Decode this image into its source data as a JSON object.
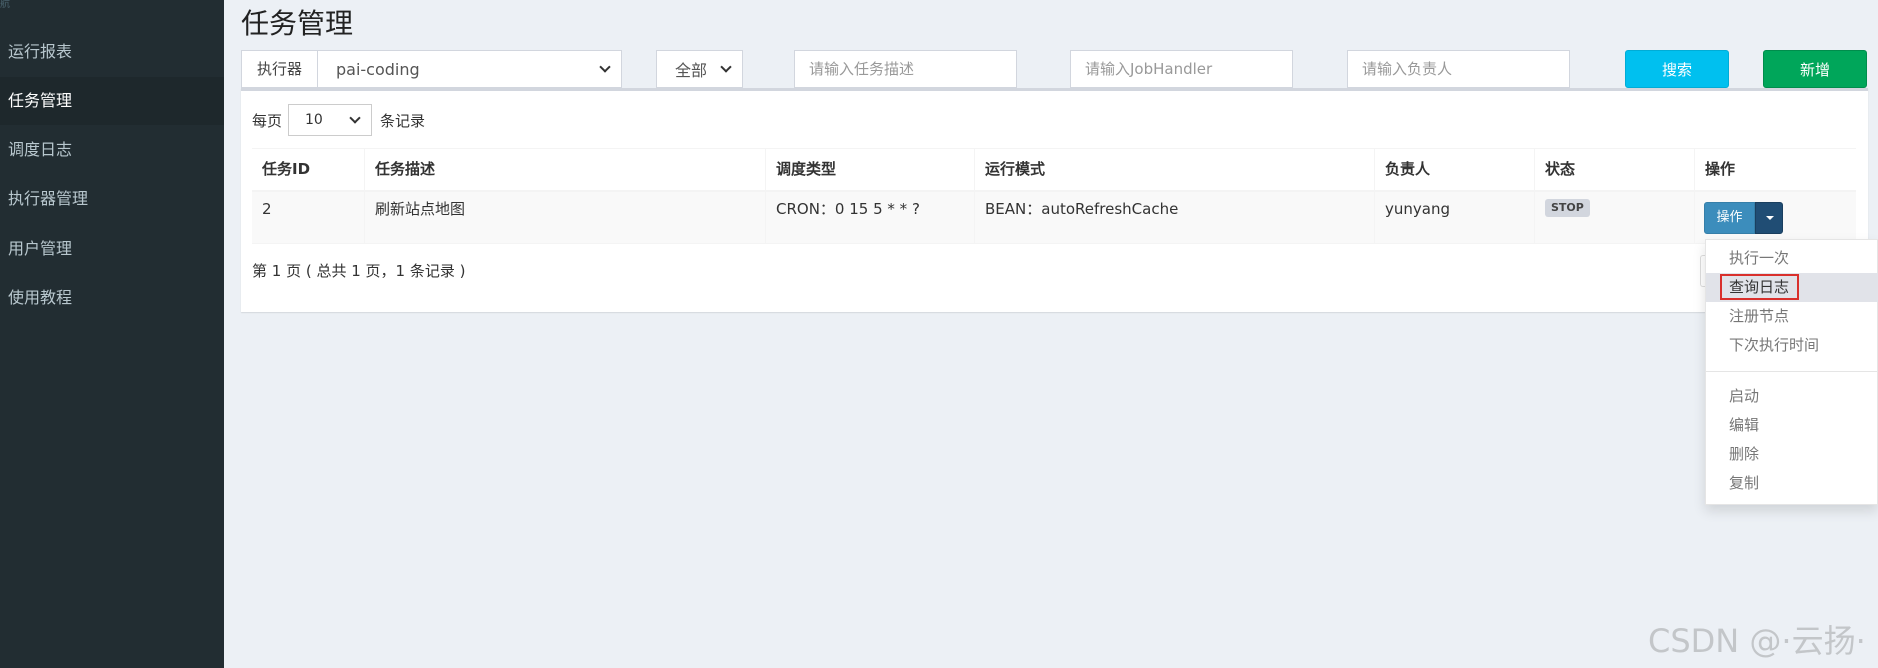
{
  "sidebar": {
    "header": "航",
    "items": [
      {
        "label": "运行报表"
      },
      {
        "label": "任务管理"
      },
      {
        "label": "调度日志"
      },
      {
        "label": "执行器管理"
      },
      {
        "label": "用户管理"
      },
      {
        "label": "使用教程"
      }
    ],
    "active_index": 1
  },
  "page": {
    "title": "任务管理"
  },
  "filters": {
    "executor_label": "执行器",
    "executor_value": "pai-coding",
    "status_value": "全部",
    "desc_placeholder": "请输入任务描述",
    "handler_placeholder": "请输入JobHandler",
    "author_placeholder": "请输入负责人",
    "search_label": "搜索",
    "add_label": "新增"
  },
  "paging": {
    "per_page_prefix": "每页",
    "per_page_value": "10",
    "per_page_suffix": "条记录",
    "info": "第 1 页 ( 总共 1 页，1 条记录 )"
  },
  "table": {
    "columns": [
      "任务ID",
      "任务描述",
      "调度类型",
      "运行模式",
      "负责人",
      "状态",
      "操作"
    ],
    "rows": [
      {
        "id": "2",
        "desc": "刷新站点地图",
        "schedule": "CRON：0 15 5 * * ?",
        "mode": "BEAN：autoRefreshCache",
        "author": "yunyang",
        "status": "STOP",
        "action": "操作"
      }
    ]
  },
  "action_menu": {
    "items": [
      "执行一次",
      "查询日志",
      "注册节点",
      "下次执行时间",
      "启动",
      "编辑",
      "删除",
      "复制"
    ],
    "highlighted": "查询日志"
  },
  "watermark": "CSDN @·云扬·",
  "colors": {
    "sidebar_bg": "#222d32",
    "search_btn": "#00c0ef",
    "add_btn": "#00a65a",
    "action_btn": "#3c8dbc",
    "highlight_outline": "#d9302c"
  }
}
